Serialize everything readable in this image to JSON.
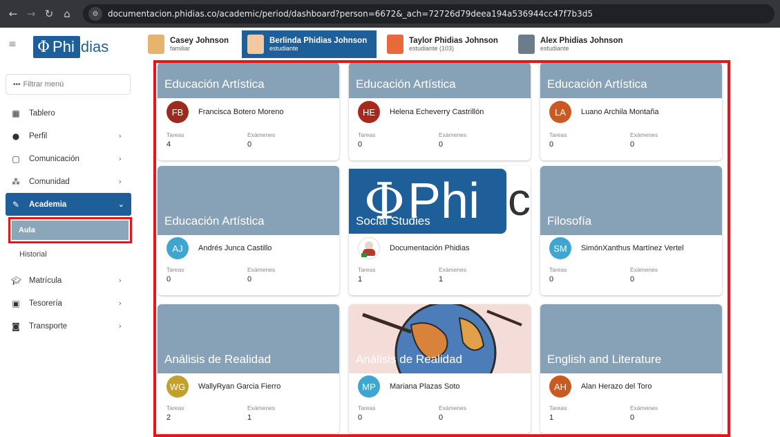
{
  "browser": {
    "url": "documentacion.phidias.co/academic/period/dashboard?person=6672&_ach=72726d79deea194a536944cc47f7b3d5"
  },
  "sidebar": {
    "logo_text": "Phidias",
    "filter_placeholder": "Filtrar menú",
    "items": [
      {
        "label": "Tablero",
        "icon": "dashboard-icon"
      },
      {
        "label": "Perfil",
        "icon": "person-icon"
      },
      {
        "label": "Comunicación",
        "icon": "message-icon"
      },
      {
        "label": "Comunidad",
        "icon": "group-icon"
      },
      {
        "label": "Academia",
        "icon": "academy-icon"
      },
      {
        "label": "Matrícula",
        "icon": "graduation-cap-icon"
      },
      {
        "label": "Tesorería",
        "icon": "money-icon"
      },
      {
        "label": "Transporte",
        "icon": "bus-icon"
      }
    ],
    "sub_items": [
      {
        "label": "Aula"
      },
      {
        "label": "Historial"
      }
    ]
  },
  "family": [
    {
      "name": "Casey Johnson",
      "role": "familiar"
    },
    {
      "name": "Berlinda Phidias Johnson",
      "role": "estudiante"
    },
    {
      "name": "Taylor Phidias Johnson",
      "role": "estudiante (103)"
    },
    {
      "name": "Alex Phidias Johnson",
      "role": "estudiante"
    }
  ],
  "labels": {
    "tasks": "Tareas",
    "exams": "Exámenes"
  },
  "courses": [
    {
      "title": "Educación Artística",
      "initials": "FB",
      "teacher": "Francisca Botero Moreno",
      "avatar_color": "#9b2a1f",
      "tasks": "4",
      "exams": "0"
    },
    {
      "title": "Educación Artística",
      "initials": "HE",
      "teacher": "Helena Echeverry Castrillón",
      "avatar_color": "#a8281e",
      "tasks": "0",
      "exams": "0"
    },
    {
      "title": "Educación Artística",
      "initials": "LA",
      "teacher": "Luano Archila Montaña",
      "avatar_color": "#c85a22",
      "tasks": "0",
      "exams": "0"
    },
    {
      "title": "Educación Artística",
      "initials": "AJ",
      "teacher": "Andrés Junca Castillo",
      "avatar_color": "#3fa6d0",
      "tasks": "0",
      "exams": "0"
    },
    {
      "title": "Social Studies",
      "initials": "",
      "teacher": "Documentación Phidias",
      "avatar_color": "#ffffff",
      "tasks": "1",
      "exams": "1"
    },
    {
      "title": "Filosofía",
      "initials": "SM",
      "teacher": "SimónXanthus Martínez Vertel",
      "avatar_color": "#3fa6d0",
      "tasks": "0",
      "exams": "0"
    },
    {
      "title": "Análisis de Realidad",
      "initials": "WG",
      "teacher": "WallyRyan Garcia Fierro",
      "avatar_color": "#c1a12c",
      "tasks": "2",
      "exams": "1"
    },
    {
      "title": "Análisis de Realidad",
      "initials": "MP",
      "teacher": "Mariana Plazas Soto",
      "avatar_color": "#3fa6d0",
      "tasks": "0",
      "exams": "0"
    },
    {
      "title": "English and Literature",
      "initials": "AH",
      "teacher": "Alan Herazo del Toro",
      "avatar_color": "#c85a22",
      "tasks": "1",
      "exams": "0"
    }
  ],
  "social_studies_banner_text": "Phi"
}
